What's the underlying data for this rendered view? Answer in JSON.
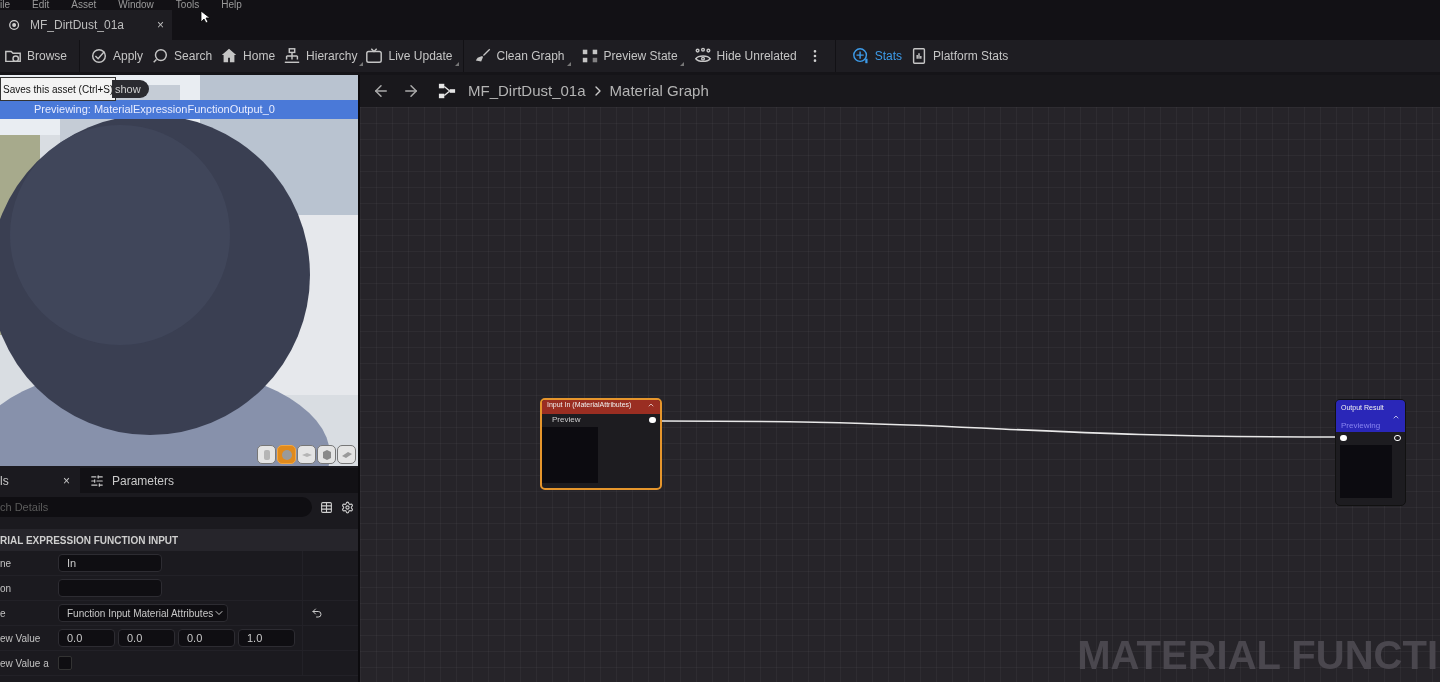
{
  "menu": [
    "ile",
    "Edit",
    "Asset",
    "Window",
    "Tools",
    "Help"
  ],
  "document_tab": {
    "title": "MF_DirtDust_01a",
    "close": "×"
  },
  "toolbar": [
    {
      "label": "Browse",
      "dropdown": false,
      "selected": false
    },
    {
      "label": "Apply",
      "dropdown": false,
      "selected": false
    },
    {
      "label": "Search",
      "dropdown": false,
      "selected": false
    },
    {
      "label": "Home",
      "dropdown": false,
      "selected": false
    },
    {
      "label": "Hierarchy",
      "dropdown": true,
      "selected": false
    },
    {
      "label": "Live Update",
      "dropdown": true,
      "selected": false
    },
    {
      "label": "Clean Graph",
      "dropdown": true,
      "selected": false
    },
    {
      "label": "Preview State",
      "dropdown": true,
      "selected": false
    },
    {
      "label": "Hide Unrelated",
      "dropdown": false,
      "selected": false
    },
    {
      "label": "Stats",
      "dropdown": false,
      "selected": true
    },
    {
      "label": "Platform Stats",
      "dropdown": false,
      "selected": false
    }
  ],
  "viewport": {
    "show_button": "show",
    "tooltip": "Saves this asset (Ctrl+S)",
    "previewing": "Previewing: MaterialExpressionFunctionOutput_0",
    "shapes": [
      {
        "kind": "cylinder",
        "selected": false
      },
      {
        "kind": "sphere",
        "selected": true
      },
      {
        "kind": "plane",
        "selected": false
      },
      {
        "kind": "cube",
        "selected": false
      },
      {
        "kind": "mesh",
        "selected": false
      }
    ]
  },
  "details": {
    "tabs": [
      {
        "label": "ls",
        "selected": true,
        "close": "×"
      },
      {
        "label": "Parameters",
        "selected": false
      }
    ],
    "search": {
      "placeholder": "ch Details"
    },
    "section": "RIAL EXPRESSION FUNCTION INPUT",
    "rows": [
      {
        "kind": "text",
        "label": "ne",
        "value": "In"
      },
      {
        "kind": "text",
        "label": "on",
        "value": ""
      },
      {
        "kind": "dropdown",
        "label": "e",
        "value": "Function Input Material Attributes",
        "resettable": true
      },
      {
        "kind": "vector",
        "label": "ew Value",
        "values": [
          "0.0",
          "0.0",
          "0.0",
          "1.0"
        ]
      },
      {
        "kind": "checkbox",
        "label": "ew Value a",
        "checked": false
      }
    ]
  },
  "graph": {
    "breadcrumb": [
      "MF_DirtDust_01a",
      "Material Graph"
    ],
    "nodes": [
      {
        "kind": "input",
        "title": "Input In (MaterialAttributes)",
        "pin": "Preview",
        "selected": true
      },
      {
        "kind": "output",
        "title": "Output Result",
        "subtitle": "Previewing",
        "selected": false
      }
    ],
    "watermark": "MATERIAL FUNCTI"
  }
}
